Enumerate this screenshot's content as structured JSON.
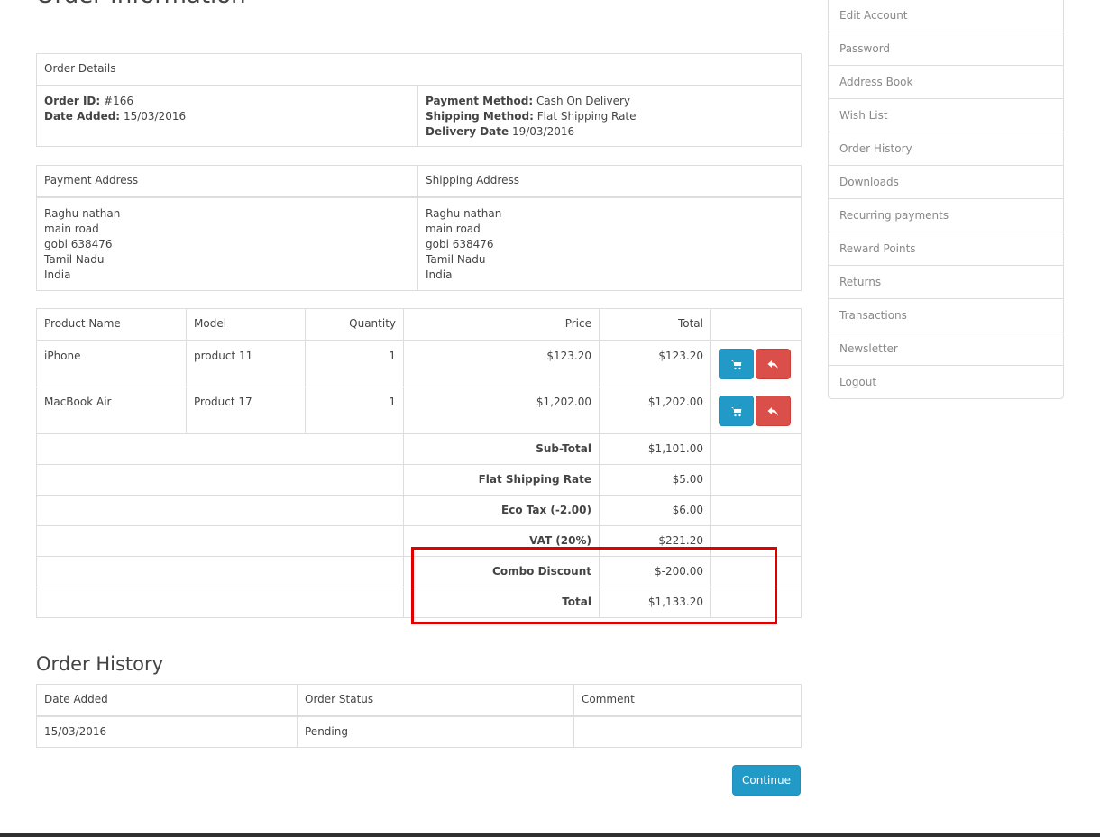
{
  "page": {
    "title": "Order Information"
  },
  "details": {
    "header": "Order Details",
    "order_id_label": "Order ID:",
    "order_id": "#166",
    "date_added_label": "Date Added:",
    "date_added": "15/03/2016",
    "payment_method_label": "Payment Method:",
    "payment_method": "Cash On Delivery",
    "shipping_method_label": "Shipping Method:",
    "shipping_method": "Flat Shipping Rate",
    "delivery_date_label": "Delivery Date",
    "delivery_date": "19/03/2016"
  },
  "addresses": {
    "payment_header": "Payment Address",
    "shipping_header": "Shipping Address",
    "payment_lines": [
      "Raghu nathan",
      "main road",
      "gobi 638476",
      "Tamil Nadu",
      "India"
    ],
    "shipping_lines": [
      "Raghu nathan",
      "main road",
      "gobi 638476",
      "Tamil Nadu",
      "India"
    ]
  },
  "products": {
    "headers": {
      "name": "Product Name",
      "model": "Model",
      "quantity": "Quantity",
      "price": "Price",
      "total": "Total"
    },
    "rows": [
      {
        "name": "iPhone",
        "model": "product 11",
        "quantity": "1",
        "price": "$123.20",
        "total": "$123.20",
        "reorder_icon": "cart-icon",
        "return_icon": "reply-icon"
      },
      {
        "name": "MacBook Air",
        "model": "Product 17",
        "quantity": "1",
        "price": "$1,202.00",
        "total": "$1,202.00",
        "reorder_icon": "cart-icon",
        "return_icon": "reply-icon"
      }
    ],
    "totals": [
      {
        "label": "Sub-Total",
        "value": "$1,101.00"
      },
      {
        "label": "Flat Shipping Rate",
        "value": "$5.00"
      },
      {
        "label": "Eco Tax (-2.00)",
        "value": "$6.00"
      },
      {
        "label": "VAT (20%)",
        "value": "$221.20"
      },
      {
        "label": "Combo Discount",
        "value": "$-200.00"
      },
      {
        "label": "Total",
        "value": "$1,133.20"
      }
    ]
  },
  "history": {
    "title": "Order History",
    "headers": {
      "date": "Date Added",
      "status": "Order Status",
      "comment": "Comment"
    },
    "rows": [
      {
        "date": "15/03/2016",
        "status": "Pending",
        "comment": ""
      }
    ]
  },
  "actions": {
    "continue_label": "Continue"
  },
  "sidebar": {
    "items": [
      {
        "label": "Edit Account"
      },
      {
        "label": "Password"
      },
      {
        "label": "Address Book"
      },
      {
        "label": "Wish List"
      },
      {
        "label": "Order History"
      },
      {
        "label": "Downloads"
      },
      {
        "label": "Recurring payments"
      },
      {
        "label": "Reward Points"
      },
      {
        "label": "Returns"
      },
      {
        "label": "Transactions"
      },
      {
        "label": "Newsletter"
      },
      {
        "label": "Logout"
      }
    ]
  },
  "colors": {
    "button_blue": "#229ac8",
    "button_red": "#da4f49",
    "highlight_box": "#e00000"
  }
}
